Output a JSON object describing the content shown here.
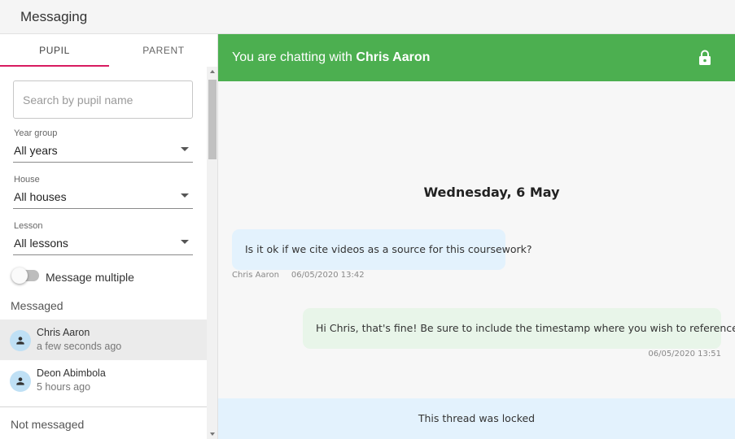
{
  "app": {
    "title": "Messaging"
  },
  "tabs": [
    {
      "label": "PUPIL",
      "active": true
    },
    {
      "label": "PARENT",
      "active": false
    }
  ],
  "filters": {
    "search": {
      "placeholder": "Search by pupil name",
      "value": ""
    },
    "year_group": {
      "label": "Year group",
      "value": "All years"
    },
    "house": {
      "label": "House",
      "value": "All houses"
    },
    "lesson": {
      "label": "Lesson",
      "value": "All lessons"
    },
    "message_multiple": {
      "label": "Message multiple",
      "on": false
    }
  },
  "sections": {
    "messaged_heading": "Messaged",
    "not_messaged_heading": "Not messaged"
  },
  "contacts": [
    {
      "name": "Chris Aaron",
      "time": "a few seconds ago",
      "selected": true
    },
    {
      "name": "Deon Abimbola",
      "time": "5 hours ago",
      "selected": false
    }
  ],
  "chat": {
    "header_prefix": "You are chatting with",
    "header_name": "Chris Aaron",
    "header_icon": "lock-icon",
    "date": "Wednesday, 6 May",
    "messages": [
      {
        "direction": "in",
        "text": "Is it ok if we cite videos as a source for this coursework?",
        "sender": "Chris Aaron",
        "timestamp": "06/05/2020 13:42"
      },
      {
        "direction": "out",
        "text": "Hi Chris, that's fine! Be sure to include the timestamp where you wish to reference from.",
        "timestamp": "06/05/2020 13:51"
      }
    ],
    "locked_notice": "This thread was locked"
  },
  "colors": {
    "header_green": "#4caf50",
    "tab_accent": "#d81b60",
    "incoming_bubble": "#e3f2fd",
    "outgoing_bubble": "#e8f5e9",
    "avatar": "#bfe0f5"
  }
}
